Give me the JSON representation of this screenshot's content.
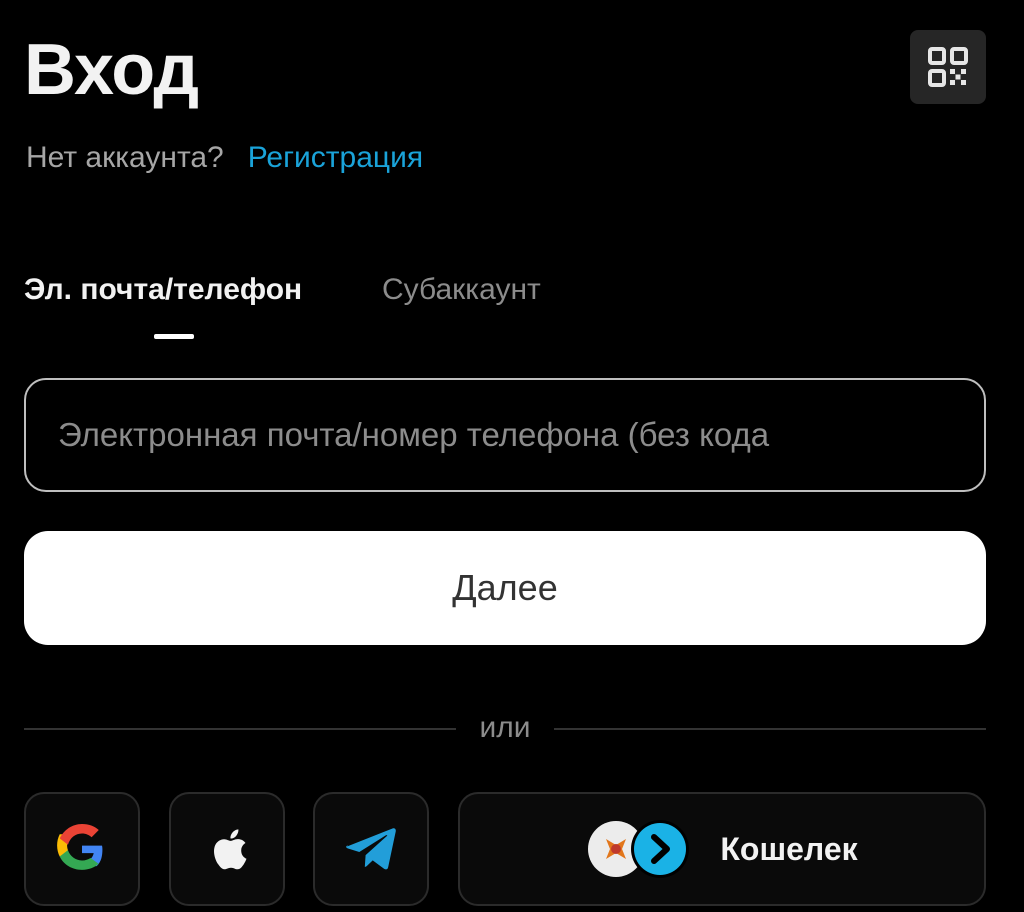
{
  "header": {
    "title": "Вход"
  },
  "signup": {
    "question": "Нет аккаунта?",
    "link": "Регистрация"
  },
  "tabs": [
    {
      "label": "Эл. почта/телефон",
      "active": true
    },
    {
      "label": "Субаккаунт",
      "active": false
    }
  ],
  "login_field": {
    "value": "",
    "placeholder": "Электронная почта/номер телефона (без кода"
  },
  "next_button": {
    "label": "Далее"
  },
  "divider": {
    "label": "или"
  },
  "social": {
    "google_icon": "google-icon",
    "apple_icon": "apple-icon",
    "telegram_icon": "telegram-icon",
    "wallet_label": "Кошелек"
  },
  "colors": {
    "background": "#000000",
    "accent_link": "#1aa3d9",
    "primary_button": "#ffffff",
    "qr_button": "#262626"
  }
}
